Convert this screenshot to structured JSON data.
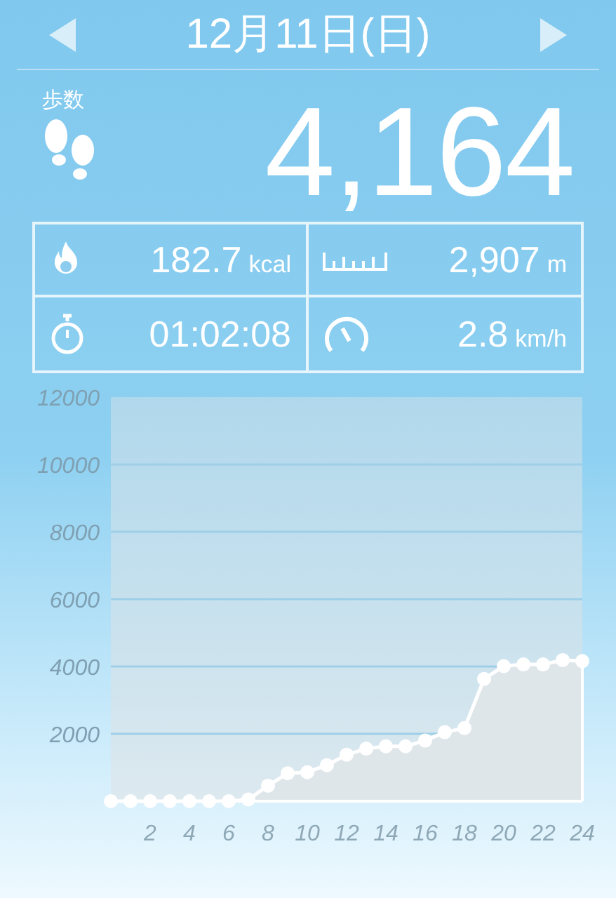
{
  "header": {
    "date": "12月11日(日)"
  },
  "steps": {
    "label": "歩数",
    "value": "4,164"
  },
  "stats": [
    {
      "kind": "calories",
      "value": "182.7",
      "unit": "kcal"
    },
    {
      "kind": "distance",
      "value": "2,907",
      "unit": "m"
    },
    {
      "kind": "time",
      "value": "01:02:08"
    },
    {
      "kind": "speed",
      "value": "2.8",
      "unit": "km/h"
    }
  ],
  "chart": {
    "chart_data": {
      "type": "area",
      "x": [
        0,
        1,
        2,
        3,
        4,
        5,
        6,
        7,
        8,
        9,
        10,
        11,
        12,
        13,
        14,
        15,
        16,
        17,
        18,
        19,
        20,
        21,
        22,
        23,
        24
      ],
      "series": [
        {
          "color": "#ffffff",
          "values": [
            0,
            0,
            0,
            0,
            0,
            0,
            0,
            50,
            460,
            830,
            860,
            1070,
            1380,
            1560,
            1630,
            1630,
            1800,
            2050,
            2170,
            3630,
            4010,
            4060,
            4060,
            4190,
            4160
          ]
        }
      ],
      "grid": true,
      "xlim": [
        0,
        24
      ],
      "ylim": [
        0,
        12000
      ],
      "xticks": [
        2,
        4,
        6,
        8,
        10,
        12,
        14,
        16,
        18,
        20,
        22,
        24
      ],
      "yticks": [
        2000,
        4000,
        6000,
        8000,
        10000,
        12000
      ]
    }
  }
}
